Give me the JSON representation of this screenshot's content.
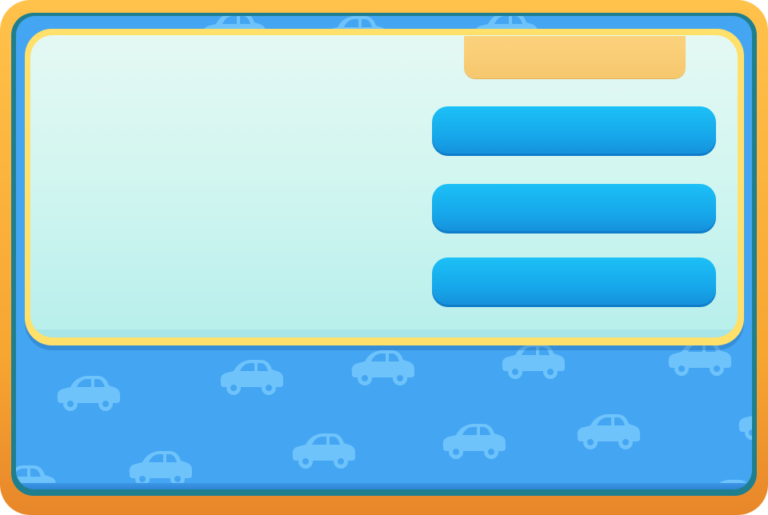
{
  "background": {
    "pattern_icon": "car-icon",
    "board_color": "#44a5f2",
    "car_color": "#6ec3fb"
  },
  "frame": {
    "color": "#f7a531"
  },
  "panel": {
    "border_color": "#ffe06a",
    "fill_color": "#d3f6f0"
  },
  "header_tab": {
    "label": "",
    "color": "#f8cf78"
  },
  "menu": {
    "buttons": [
      {
        "label": "",
        "color": "#16a7ea"
      },
      {
        "label": "",
        "color": "#16a7ea"
      },
      {
        "label": "",
        "color": "#16a7ea"
      }
    ]
  }
}
